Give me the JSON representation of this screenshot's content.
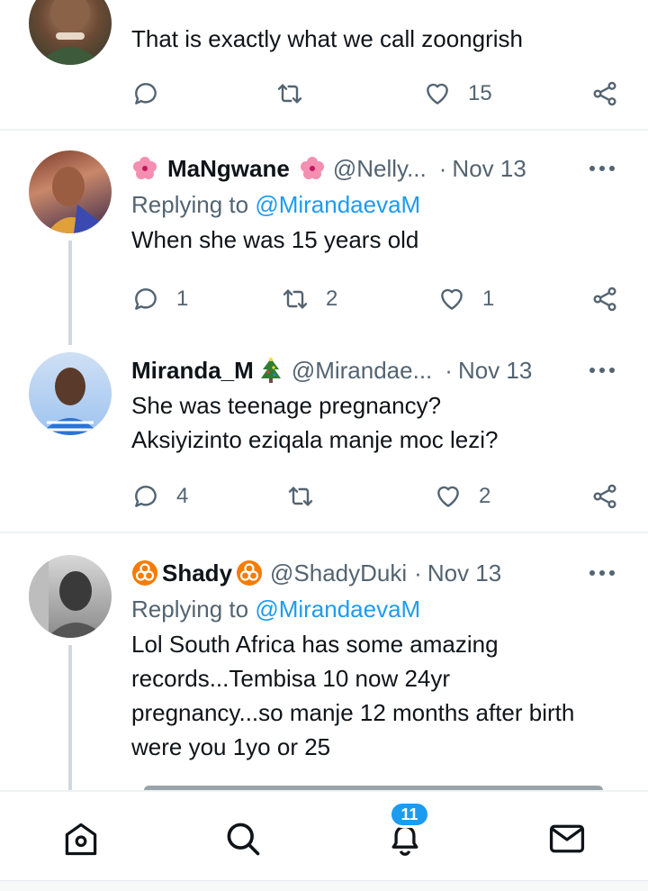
{
  "tweets": [
    {
      "text_lines": [
        "That is exactly what we call zoongrish"
      ],
      "replies": "",
      "retweets": "",
      "likes": "15"
    },
    {
      "name": "MaNgwane",
      "handle": "@Nelly...",
      "date": "Nov 13",
      "replying_prefix": "Replying to",
      "replying_to": "@MirandaevaM",
      "text_lines": [
        "When she was 15 years old"
      ],
      "replies": "1",
      "retweets": "2",
      "likes": "1"
    },
    {
      "name": "Miranda_M",
      "handle": "@Mirandae...",
      "date": "Nov 13",
      "text_lines": [
        "She was teenage pregnancy?",
        "Aksiyizinto eziqala manje moc lezi?"
      ],
      "replies": "4",
      "retweets": "",
      "likes": "2"
    },
    {
      "name": "Shady",
      "handle": "@ShadyDuki",
      "date": "Nov 13",
      "replying_prefix": "Replying to",
      "replying_to": "@MirandaevaM",
      "text_lines": [
        "Lol South Africa has some amazing",
        "records...Tembisa 10 now 24yr",
        "pregnancy...so manje 12 months after birth",
        "were you 1yo or 25"
      ],
      "replies": "",
      "retweets": "",
      "likes": ""
    }
  ],
  "separator": "·",
  "nav": {
    "notifications_badge": "11",
    "items": [
      "home-icon",
      "search-icon",
      "notifications-icon",
      "messages-icon"
    ]
  },
  "colors": {
    "accent": "#1d9bf0",
    "text": "#0f1419",
    "secondary": "#536471",
    "divider": "#eff3f4"
  }
}
